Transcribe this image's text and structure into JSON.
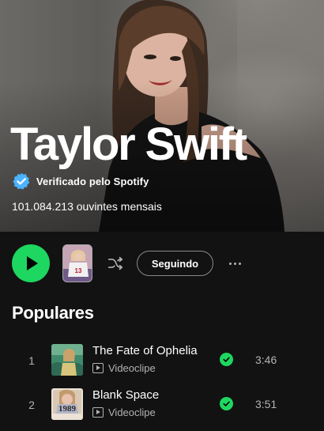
{
  "artist": {
    "name": "Taylor Swift",
    "verified_label": "Verificado pelo Spotify",
    "monthly_listeners": "101.084.213 ouvintes mensais"
  },
  "actions": {
    "follow_label": "Seguindo",
    "preview_jersey_number": "13"
  },
  "popular": {
    "title": "Populares",
    "tracks": [
      {
        "index": "1",
        "title": "The Fate of Ophelia",
        "subtitle": "Videoclipe",
        "saved": true,
        "duration": "3:46"
      },
      {
        "index": "2",
        "title": "Blank Space",
        "subtitle": "Videoclipe",
        "saved": true,
        "duration": "3:51",
        "art_text": "1989"
      }
    ]
  },
  "colors": {
    "accent_green": "#1ed760",
    "background": "#121212",
    "secondary_text": "#b3b3b3"
  }
}
